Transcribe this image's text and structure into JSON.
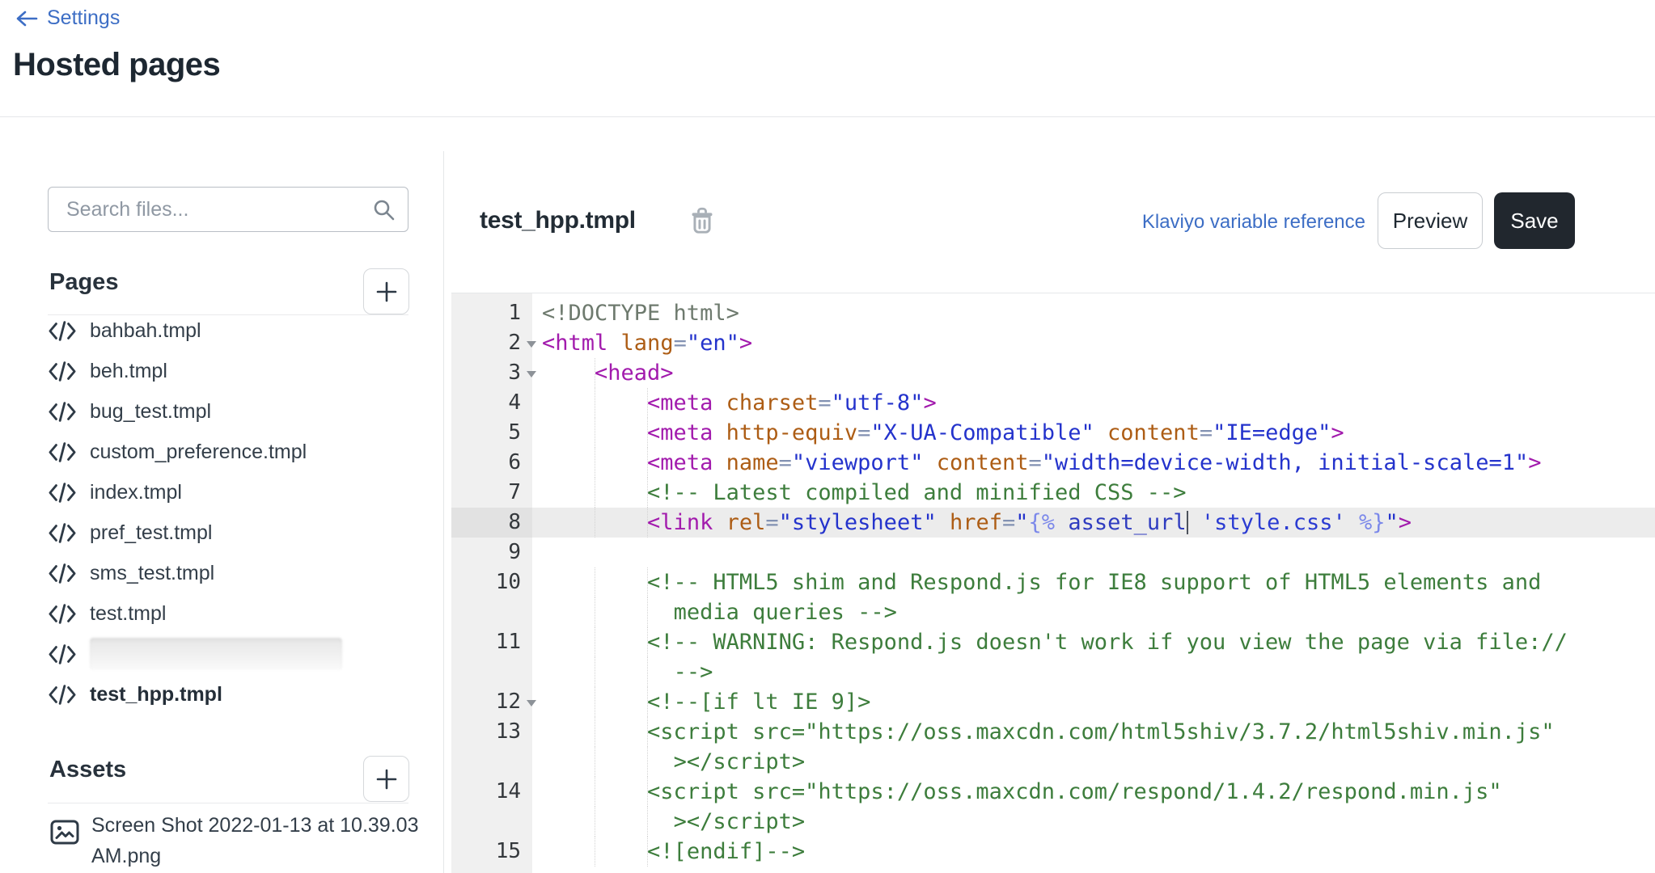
{
  "header": {
    "back_label": "Settings",
    "title": "Hosted pages"
  },
  "sidebar": {
    "search_placeholder": "Search files...",
    "pages_heading": "Pages",
    "assets_heading": "Assets",
    "files": [
      {
        "name": "bahbah.tmpl"
      },
      {
        "name": "beh.tmpl"
      },
      {
        "name": "bug_test.tmpl"
      },
      {
        "name": "custom_preference.tmpl"
      },
      {
        "name": "index.tmpl"
      },
      {
        "name": "pref_test.tmpl"
      },
      {
        "name": "sms_test.tmpl"
      },
      {
        "name": "test.tmpl"
      },
      {
        "name": "",
        "redacted": true
      },
      {
        "name": "test_hpp.tmpl",
        "selected": true
      }
    ],
    "assets": [
      {
        "name": "Screen Shot 2022-01-13 at 10.39.03 AM.png"
      }
    ]
  },
  "main": {
    "file_title": "test_hpp.tmpl",
    "reference_link": "Klaviyo variable reference",
    "preview_label": "Preview",
    "save_label": "Save"
  },
  "colors": {
    "link_blue": "#3d6ec5",
    "heading_dark": "#1d2731",
    "divider": "#e5e7e9",
    "button_border": "#c9cdd1",
    "save_button_bg": "#21272e",
    "save_button_text": "#ffffff",
    "placeholder": "#8f98a3",
    "gutter_bg": "#f0f0f0",
    "active_line_bg": "#ececec",
    "active_gutter_bg": "#e2e2e2",
    "syntax_doctype": "#6e7a6e",
    "syntax_tag": "#a21bad",
    "syntax_attr": "#ad5d15",
    "syntax_equals": "#8291b2",
    "syntax_string": "#2433cc",
    "syntax_comment": "#3d7d3c",
    "syntax_template_delim": "#7b88ea",
    "syntax_template_var": "#2f3cc0",
    "syntax_template_string": "#2a3bd2"
  },
  "editor": {
    "rows": [
      {
        "n": "1",
        "segs": [
          [
            "dt",
            "<!DOCTYPE html>"
          ]
        ]
      },
      {
        "n": "2",
        "fold": true,
        "segs": [
          [
            "tag",
            "<html"
          ],
          [
            "pl",
            " "
          ],
          [
            "at",
            "lang"
          ],
          [
            "eq",
            "="
          ],
          [
            "st",
            "\"en\""
          ],
          [
            "tag",
            ">"
          ]
        ]
      },
      {
        "n": "3",
        "fold": true,
        "g1": true,
        "segs": [
          [
            "pl",
            "    "
          ],
          [
            "tag",
            "<head>"
          ]
        ]
      },
      {
        "n": "4",
        "g1": true,
        "g2": true,
        "segs": [
          [
            "pl",
            "        "
          ],
          [
            "tag",
            "<meta"
          ],
          [
            "pl",
            " "
          ],
          [
            "at",
            "charset"
          ],
          [
            "eq",
            "="
          ],
          [
            "st",
            "\"utf-8\""
          ],
          [
            "tag",
            ">"
          ]
        ]
      },
      {
        "n": "5",
        "g1": true,
        "g2": true,
        "segs": [
          [
            "pl",
            "        "
          ],
          [
            "tag",
            "<meta"
          ],
          [
            "pl",
            " "
          ],
          [
            "at",
            "http-equiv"
          ],
          [
            "eq",
            "="
          ],
          [
            "st",
            "\"X-UA-Compatible\""
          ],
          [
            "pl",
            " "
          ],
          [
            "at",
            "content"
          ],
          [
            "eq",
            "="
          ],
          [
            "st",
            "\"IE=edge\""
          ],
          [
            "tag",
            ">"
          ]
        ]
      },
      {
        "n": "6",
        "g1": true,
        "g2": true,
        "segs": [
          [
            "pl",
            "        "
          ],
          [
            "tag",
            "<meta"
          ],
          [
            "pl",
            " "
          ],
          [
            "at",
            "name"
          ],
          [
            "eq",
            "="
          ],
          [
            "st",
            "\"viewport\""
          ],
          [
            "pl",
            " "
          ],
          [
            "at",
            "content"
          ],
          [
            "eq",
            "="
          ],
          [
            "st",
            "\"width=device-width, initial-scale=1\""
          ],
          [
            "tag",
            ">"
          ]
        ]
      },
      {
        "n": "7",
        "g1": true,
        "g2": true,
        "segs": [
          [
            "pl",
            "        "
          ],
          [
            "cm",
            "<!-- Latest compiled and minified CSS -->"
          ]
        ]
      },
      {
        "n": "8",
        "active": true,
        "g1": true,
        "g2": true,
        "segs": [
          [
            "pl",
            "        "
          ],
          [
            "tag",
            "<link"
          ],
          [
            "pl",
            " "
          ],
          [
            "at",
            "rel"
          ],
          [
            "eq",
            "="
          ],
          [
            "st",
            "\"stylesheet\""
          ],
          [
            "pl",
            " "
          ],
          [
            "at",
            "href"
          ],
          [
            "eq",
            "="
          ],
          [
            "st",
            "\""
          ],
          [
            "tp",
            "{% "
          ],
          [
            "tv",
            "asset_url"
          ],
          [
            "cur",
            ""
          ],
          [
            "pl",
            " "
          ],
          [
            "ts",
            "'style.css'"
          ],
          [
            "tp",
            " %}"
          ],
          [
            "st",
            "\""
          ],
          [
            "tag",
            ">"
          ]
        ]
      },
      {
        "n": "9",
        "segs": []
      },
      {
        "n": "10",
        "g1": true,
        "g2": true,
        "segs": [
          [
            "pl",
            "        "
          ],
          [
            "cm",
            "<!-- HTML5 shim and Respond.js for IE8 support of HTML5 elements and"
          ]
        ]
      },
      {
        "n": "",
        "g1": true,
        "g2": true,
        "segs": [
          [
            "pl",
            "          "
          ],
          [
            "cm",
            "media queries -->"
          ]
        ]
      },
      {
        "n": "11",
        "g1": true,
        "g2": true,
        "segs": [
          [
            "pl",
            "        "
          ],
          [
            "cm",
            "<!-- WARNING: Respond.js doesn't work if you view the page via file://"
          ]
        ]
      },
      {
        "n": "",
        "g1": true,
        "g2": true,
        "segs": [
          [
            "pl",
            "          "
          ],
          [
            "cm",
            "-->"
          ]
        ]
      },
      {
        "n": "12",
        "fold": true,
        "g1": true,
        "g2": true,
        "segs": [
          [
            "pl",
            "        "
          ],
          [
            "cm",
            "<!--[if lt IE 9]>"
          ]
        ]
      },
      {
        "n": "13",
        "g1": true,
        "g2": true,
        "segs": [
          [
            "pl",
            "        "
          ],
          [
            "cm",
            "<script src=\"https://oss.maxcdn.com/html5shiv/3.7.2/html5shiv.min.js\""
          ]
        ]
      },
      {
        "n": "",
        "g1": true,
        "g2": true,
        "segs": [
          [
            "pl",
            "          "
          ],
          [
            "cm",
            "></script>"
          ]
        ]
      },
      {
        "n": "14",
        "g1": true,
        "g2": true,
        "segs": [
          [
            "pl",
            "        "
          ],
          [
            "cm",
            "<script src=\"https://oss.maxcdn.com/respond/1.4.2/respond.min.js\""
          ]
        ]
      },
      {
        "n": "",
        "g1": true,
        "g2": true,
        "segs": [
          [
            "pl",
            "          "
          ],
          [
            "cm",
            "></script>"
          ]
        ]
      },
      {
        "n": "15",
        "g1": true,
        "g2": true,
        "segs": [
          [
            "pl",
            "        "
          ],
          [
            "cm",
            "<![endif]-->"
          ]
        ]
      }
    ]
  }
}
